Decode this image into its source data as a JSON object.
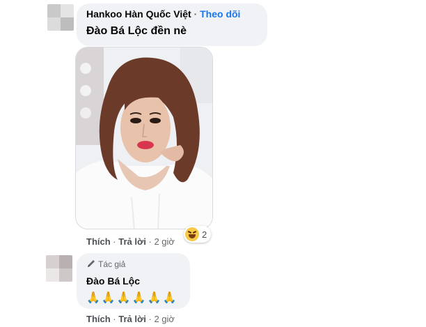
{
  "comment1": {
    "author": "Hankoo Hàn Quốc Việt",
    "separator": "·",
    "follow_label": "Theo dõi",
    "text": "Đào Bá Lộc đền nè",
    "photo_alt": "woman-portrait-photo",
    "reaction": {
      "icon": "haha-emoji-icon",
      "count": "2"
    },
    "actions": {
      "like": "Thích",
      "sep1": "·",
      "reply": "Trả lời",
      "sep2": "·",
      "time": "2 giờ"
    }
  },
  "comment2": {
    "badge_label": "Tác giả",
    "author": "Đào Bá Lộc",
    "text": "🙏🙏🙏🙏🙏🙏",
    "actions": {
      "like": "Thích",
      "sep1": "·",
      "reply": "Trả lời",
      "sep2": "·",
      "time": "2 giờ"
    }
  },
  "colors": {
    "bubble": "#f0f2f5",
    "link": "#1877f2",
    "muted": "#65676b"
  }
}
